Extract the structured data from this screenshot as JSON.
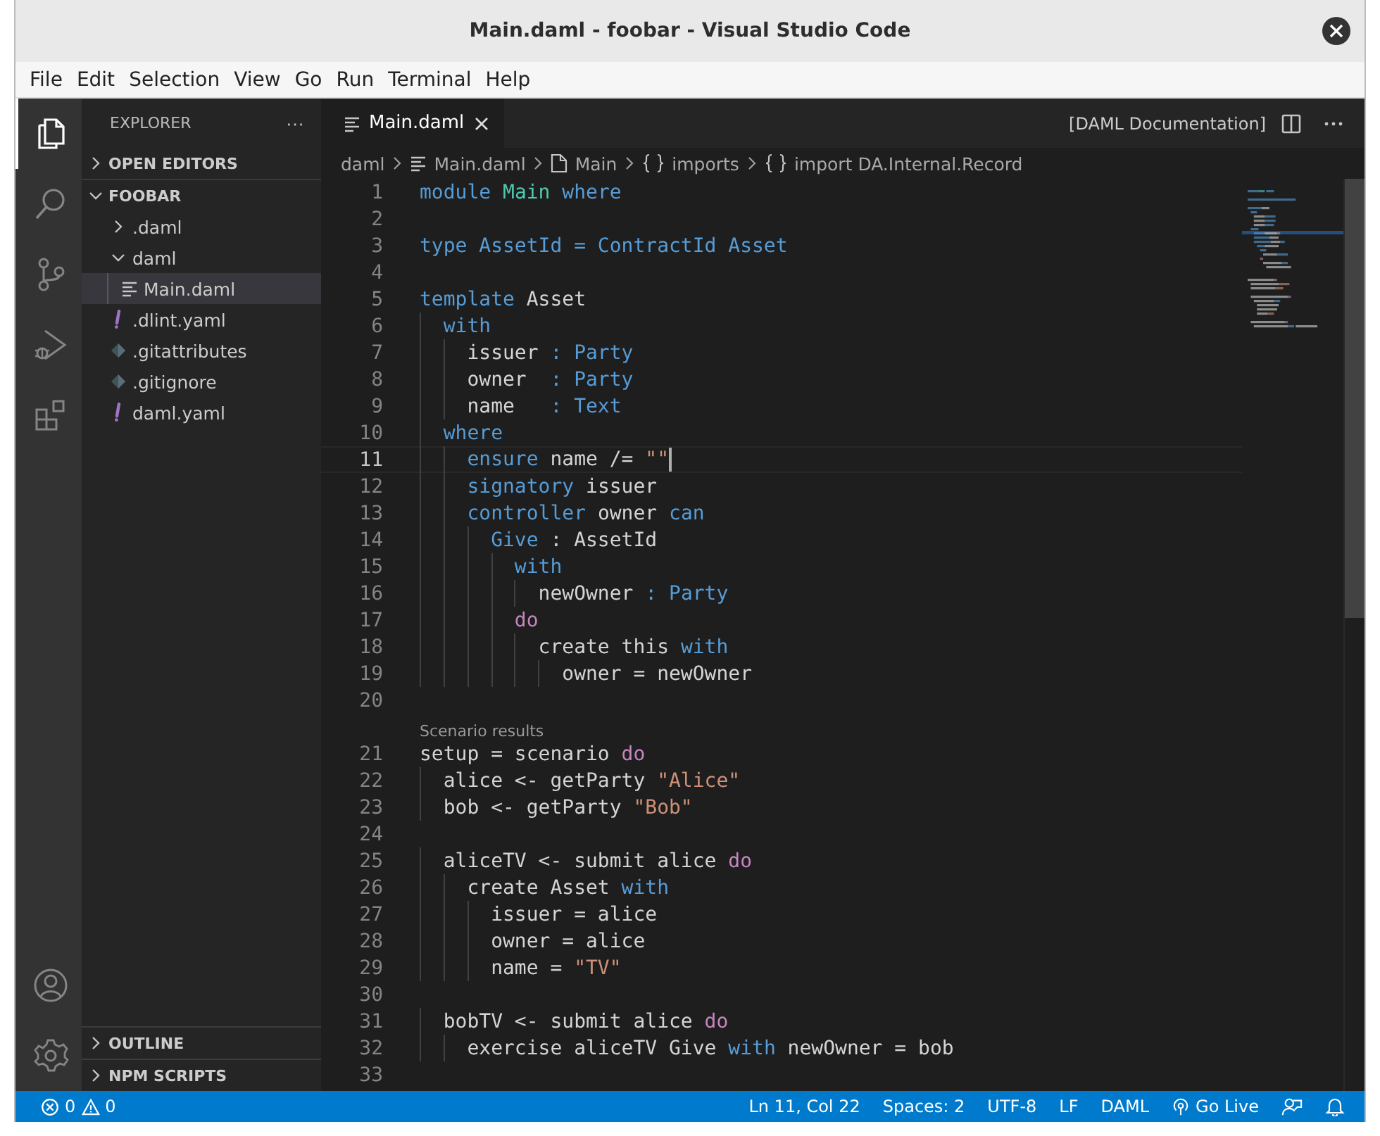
{
  "window": {
    "title": "Main.daml - foobar - Visual Studio Code"
  },
  "menu": [
    "File",
    "Edit",
    "Selection",
    "View",
    "Go",
    "Run",
    "Terminal",
    "Help"
  ],
  "activity_bar": {
    "items": [
      {
        "kind": "files",
        "selected": true
      },
      {
        "kind": "search",
        "selected": false
      },
      {
        "kind": "source-control",
        "selected": false
      },
      {
        "kind": "run",
        "selected": false
      },
      {
        "kind": "extensions",
        "selected": false
      }
    ],
    "bottom": [
      {
        "kind": "account"
      },
      {
        "kind": "settings"
      }
    ]
  },
  "sidebar": {
    "title": "EXPLORER",
    "more": "···",
    "sections": [
      {
        "label": "OPEN EDITORS",
        "expanded": false
      },
      {
        "label": "FOOBAR",
        "expanded": true,
        "items": [
          {
            "label": ".daml",
            "kind": "folder",
            "expanded": false,
            "selected": false
          },
          {
            "label": "daml",
            "kind": "folder",
            "expanded": true,
            "selected": false,
            "children": [
              {
                "label": "Main.daml",
                "kind": "daml",
                "selected": true
              }
            ]
          },
          {
            "label": ".dlint.yaml",
            "kind": "yaml",
            "selected": false
          },
          {
            "label": ".gitattributes",
            "kind": "git",
            "selected": false
          },
          {
            "label": ".gitignore",
            "kind": "git",
            "selected": false
          },
          {
            "label": "daml.yaml",
            "kind": "yaml",
            "selected": false
          }
        ]
      }
    ],
    "bottom_sections": [
      {
        "label": "OUTLINE",
        "expanded": false
      },
      {
        "label": "NPM SCRIPTS",
        "expanded": false
      }
    ]
  },
  "tabs": [
    {
      "label": "Main.daml",
      "selected": true
    }
  ],
  "editor_actions": {
    "label": "[DAML Documentation]"
  },
  "breadcrumbs": [
    {
      "label": "daml",
      "kind": "folder"
    },
    {
      "label": "Main.daml",
      "kind": "daml"
    },
    {
      "label": "Main",
      "kind": "module"
    },
    {
      "label": "imports",
      "kind": "braces"
    },
    {
      "label": "import DA.Internal.Record",
      "kind": "braces"
    }
  ],
  "lines": [
    {
      "kind": "code",
      "number": "1",
      "current": false,
      "tokens": [
        {
          "kind": "keyword",
          "text": "module "
        },
        {
          "kind": "type",
          "text": "Main"
        },
        {
          "kind": "keyword",
          "text": " where"
        }
      ]
    },
    {
      "kind": "code",
      "number": "2",
      "current": false
    },
    {
      "kind": "code",
      "number": "3",
      "current": false,
      "tokens": [
        {
          "kind": "keyword",
          "text": "type AssetId = ContractId Asset"
        }
      ]
    },
    {
      "kind": "code",
      "number": "4",
      "current": false
    },
    {
      "kind": "code",
      "number": "5",
      "current": false,
      "tokens": [
        {
          "kind": "keyword",
          "text": "template "
        },
        {
          "kind": "plain",
          "text": "Asset"
        }
      ]
    },
    {
      "kind": "code",
      "number": "6",
      "current": false,
      "tokens": [
        {
          "kind": "keyword",
          "text": "  with"
        }
      ]
    },
    {
      "kind": "code",
      "number": "7",
      "current": false,
      "tokens": [
        {
          "kind": "plain",
          "text": "    issuer "
        },
        {
          "kind": "keyword",
          "text": ": Party"
        }
      ]
    },
    {
      "kind": "code",
      "number": "8",
      "current": false,
      "tokens": [
        {
          "kind": "plain",
          "text": "    owner  "
        },
        {
          "kind": "keyword",
          "text": ": Party"
        }
      ]
    },
    {
      "kind": "code",
      "number": "9",
      "current": false,
      "tokens": [
        {
          "kind": "plain",
          "text": "    name   "
        },
        {
          "kind": "keyword",
          "text": ": Text"
        }
      ]
    },
    {
      "kind": "code",
      "number": "10",
      "current": false,
      "tokens": [
        {
          "kind": "keyword",
          "text": "  where"
        }
      ]
    },
    {
      "kind": "code",
      "number": "11",
      "current": true,
      "tokens": [
        {
          "kind": "keyword",
          "text": "    ensure "
        },
        {
          "kind": "plain",
          "text": "name /= "
        },
        {
          "kind": "string",
          "text": "\"\""
        }
      ]
    },
    {
      "kind": "code",
      "number": "12",
      "current": false,
      "tokens": [
        {
          "kind": "keyword",
          "text": "    signatory "
        },
        {
          "kind": "plain",
          "text": "issuer"
        }
      ]
    },
    {
      "kind": "code",
      "number": "13",
      "current": false,
      "tokens": [
        {
          "kind": "keyword",
          "text": "    controller "
        },
        {
          "kind": "plain",
          "text": "owner "
        },
        {
          "kind": "keyword",
          "text": "can"
        }
      ]
    },
    {
      "kind": "code",
      "number": "14",
      "current": false,
      "tokens": [
        {
          "kind": "keyword",
          "text": "      Give "
        },
        {
          "kind": "plain",
          "text": ": AssetId"
        }
      ]
    },
    {
      "kind": "code",
      "number": "15",
      "current": false,
      "tokens": [
        {
          "kind": "keyword",
          "text": "        with"
        }
      ]
    },
    {
      "kind": "code",
      "number": "16",
      "current": false,
      "tokens": [
        {
          "kind": "plain",
          "text": "          newOwner "
        },
        {
          "kind": "keyword",
          "text": ": Party"
        }
      ]
    },
    {
      "kind": "code",
      "number": "17",
      "current": false,
      "tokens": [
        {
          "kind": "control",
          "text": "        do"
        }
      ]
    },
    {
      "kind": "code",
      "number": "18",
      "current": false,
      "tokens": [
        {
          "kind": "plain",
          "text": "          create this "
        },
        {
          "kind": "keyword",
          "text": "with"
        }
      ]
    },
    {
      "kind": "code",
      "number": "19",
      "current": false,
      "tokens": [
        {
          "kind": "plain",
          "text": "            owner = newOwner"
        }
      ]
    },
    {
      "kind": "code",
      "number": "20",
      "current": false
    },
    {
      "kind": "lens",
      "text": "Scenario results"
    },
    {
      "kind": "code",
      "number": "21",
      "current": false,
      "tokens": [
        {
          "kind": "plain",
          "text": "setup = scenario "
        },
        {
          "kind": "control",
          "text": "do"
        }
      ]
    },
    {
      "kind": "code",
      "number": "22",
      "current": false,
      "tokens": [
        {
          "kind": "plain",
          "text": "  alice <- getParty "
        },
        {
          "kind": "string",
          "text": "\"Alice\""
        }
      ]
    },
    {
      "kind": "code",
      "number": "23",
      "current": false,
      "tokens": [
        {
          "kind": "plain",
          "text": "  bob <- getParty "
        },
        {
          "kind": "string",
          "text": "\"Bob\""
        }
      ]
    },
    {
      "kind": "code",
      "number": "24",
      "current": false
    },
    {
      "kind": "code",
      "number": "25",
      "current": false,
      "tokens": [
        {
          "kind": "plain",
          "text": "  aliceTV <- submit alice "
        },
        {
          "kind": "control",
          "text": "do"
        }
      ]
    },
    {
      "kind": "code",
      "number": "26",
      "current": false,
      "tokens": [
        {
          "kind": "plain",
          "text": "    create Asset "
        },
        {
          "kind": "keyword",
          "text": "with"
        }
      ]
    },
    {
      "kind": "code",
      "number": "27",
      "current": false,
      "tokens": [
        {
          "kind": "plain",
          "text": "      issuer = alice"
        }
      ]
    },
    {
      "kind": "code",
      "number": "28",
      "current": false,
      "tokens": [
        {
          "kind": "plain",
          "text": "      owner = alice"
        }
      ]
    },
    {
      "kind": "code",
      "number": "29",
      "current": false,
      "tokens": [
        {
          "kind": "plain",
          "text": "      name = "
        },
        {
          "kind": "string",
          "text": "\"TV\""
        }
      ]
    },
    {
      "kind": "code",
      "number": "30",
      "current": false
    },
    {
      "kind": "code",
      "number": "31",
      "current": false,
      "tokens": [
        {
          "kind": "plain",
          "text": "  bobTV <- submit alice "
        },
        {
          "kind": "control",
          "text": "do"
        }
      ]
    },
    {
      "kind": "code",
      "number": "32",
      "current": false,
      "tokens": [
        {
          "kind": "plain",
          "text": "    exercise aliceTV Give "
        },
        {
          "kind": "keyword",
          "text": "with"
        },
        {
          "kind": "plain",
          "text": " newOwner = bob"
        }
      ]
    },
    {
      "kind": "code",
      "number": "33",
      "current": false
    }
  ],
  "status_bar": {
    "errors": "0",
    "warnings": "0",
    "items": [
      {
        "kind": "text",
        "text": "Ln 11, Col 22"
      },
      {
        "kind": "text",
        "text": "Spaces: 2"
      },
      {
        "kind": "text",
        "text": "UTF-8"
      },
      {
        "kind": "text",
        "text": "LF"
      },
      {
        "kind": "text",
        "text": "DAML"
      },
      {
        "kind": "live",
        "text": "Go Live"
      },
      {
        "kind": "feedback"
      },
      {
        "kind": "bell"
      }
    ]
  }
}
